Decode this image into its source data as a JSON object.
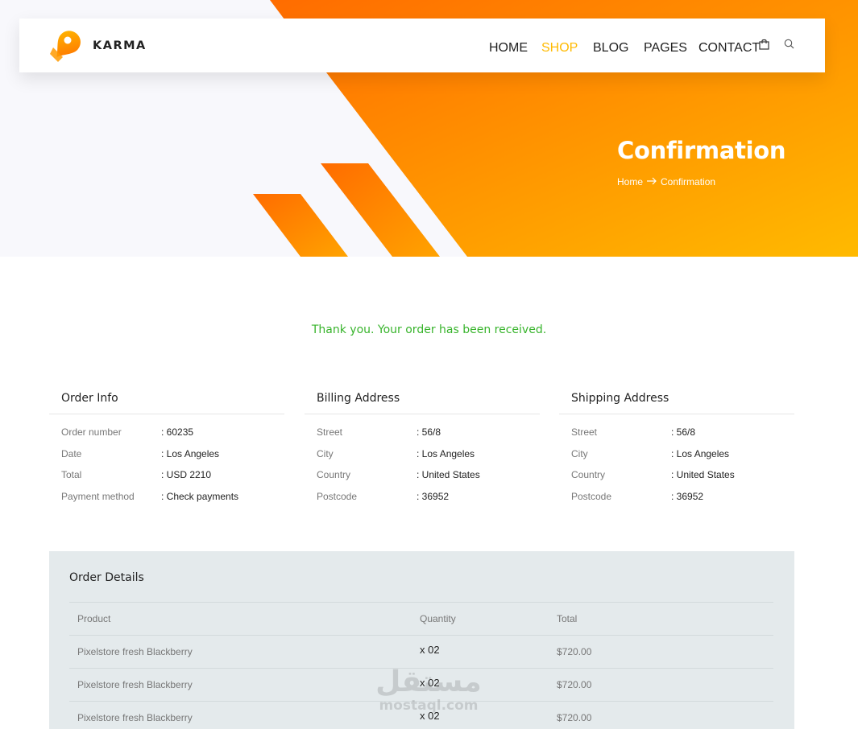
{
  "brand": {
    "name": "KARMA",
    "accent": "#ffba00",
    "gradient_from": "#ff6c00",
    "gradient_to": "#ffba00",
    "logo_icon": "pin-tag-logo-icon"
  },
  "nav": {
    "items": [
      "HOME",
      "SHOP",
      "BLOG",
      "PAGES",
      "CONTACT"
    ],
    "active": "SHOP",
    "icons": [
      "shopping-bag-icon",
      "search-icon"
    ]
  },
  "banner": {
    "title": "Confirmation",
    "breadcrumb": {
      "home": "Home",
      "current": "Confirmation",
      "separator_icon": "arrow-right-icon"
    }
  },
  "thanks": {
    "message": "Thank you. Your order has been received.",
    "color": "#38b42c"
  },
  "order_info": {
    "title": "Order Info",
    "rows": [
      {
        "label": "Order number",
        "value": ": 60235"
      },
      {
        "label": "Date",
        "value": ": Los Angeles"
      },
      {
        "label": "Total",
        "value": ": USD 2210"
      },
      {
        "label": "Payment method",
        "value": ": Check payments"
      }
    ]
  },
  "billing": {
    "title": "Billing Address",
    "rows": [
      {
        "label": "Street",
        "value": ": 56/8"
      },
      {
        "label": "City",
        "value": ": Los Angeles"
      },
      {
        "label": "Country",
        "value": ": United States"
      },
      {
        "label": "Postcode",
        "value": ": 36952"
      }
    ]
  },
  "shipping": {
    "title": "Shipping Address",
    "rows": [
      {
        "label": "Street",
        "value": ": 56/8"
      },
      {
        "label": "City",
        "value": ": Los Angeles"
      },
      {
        "label": "Country",
        "value": ": United States"
      },
      {
        "label": "Postcode",
        "value": ": 36952"
      }
    ]
  },
  "order_details": {
    "title": "Order Details",
    "headers": {
      "product": "Product",
      "quantity": "Quantity",
      "total": "Total"
    },
    "rows": [
      {
        "product": "Pixelstore fresh Blackberry",
        "quantity": "x 02",
        "total": "$720.00"
      },
      {
        "product": "Pixelstore fresh Blackberry",
        "quantity": "x 02",
        "total": "$720.00"
      },
      {
        "product": "Pixelstore fresh Blackberry",
        "quantity": "x 02",
        "total": "$720.00"
      }
    ]
  },
  "watermark": {
    "arabic": "مستقل",
    "latin": "mostaql.com"
  }
}
